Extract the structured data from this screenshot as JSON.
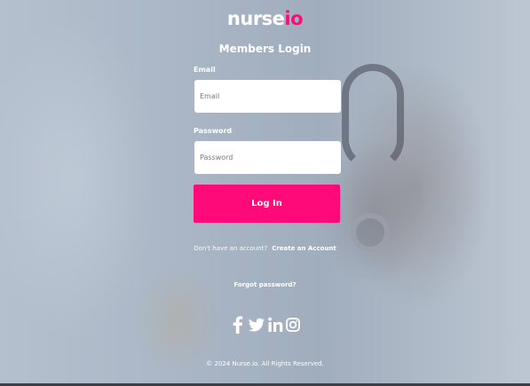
{
  "brand": {
    "logo_part1": "nurse",
    "logo_part2": "io",
    "accent_color": "#ff0a78"
  },
  "form": {
    "title": "Members Login",
    "email_label": "Email",
    "email_placeholder": "Email",
    "password_label": "Password",
    "password_placeholder": "Password",
    "login_button": "Log In"
  },
  "links": {
    "no_account_text": "Don't have an account?",
    "create_account": "Create an Account",
    "forgot_password": "Forgot password?"
  },
  "social": [
    {
      "icon": "facebook-icon"
    },
    {
      "icon": "twitter-icon"
    },
    {
      "icon": "linkedin-icon"
    },
    {
      "icon": "instagram-icon"
    }
  ],
  "footer": {
    "copyright": "© 2024 Nurse.io. All Rights Reserved."
  }
}
